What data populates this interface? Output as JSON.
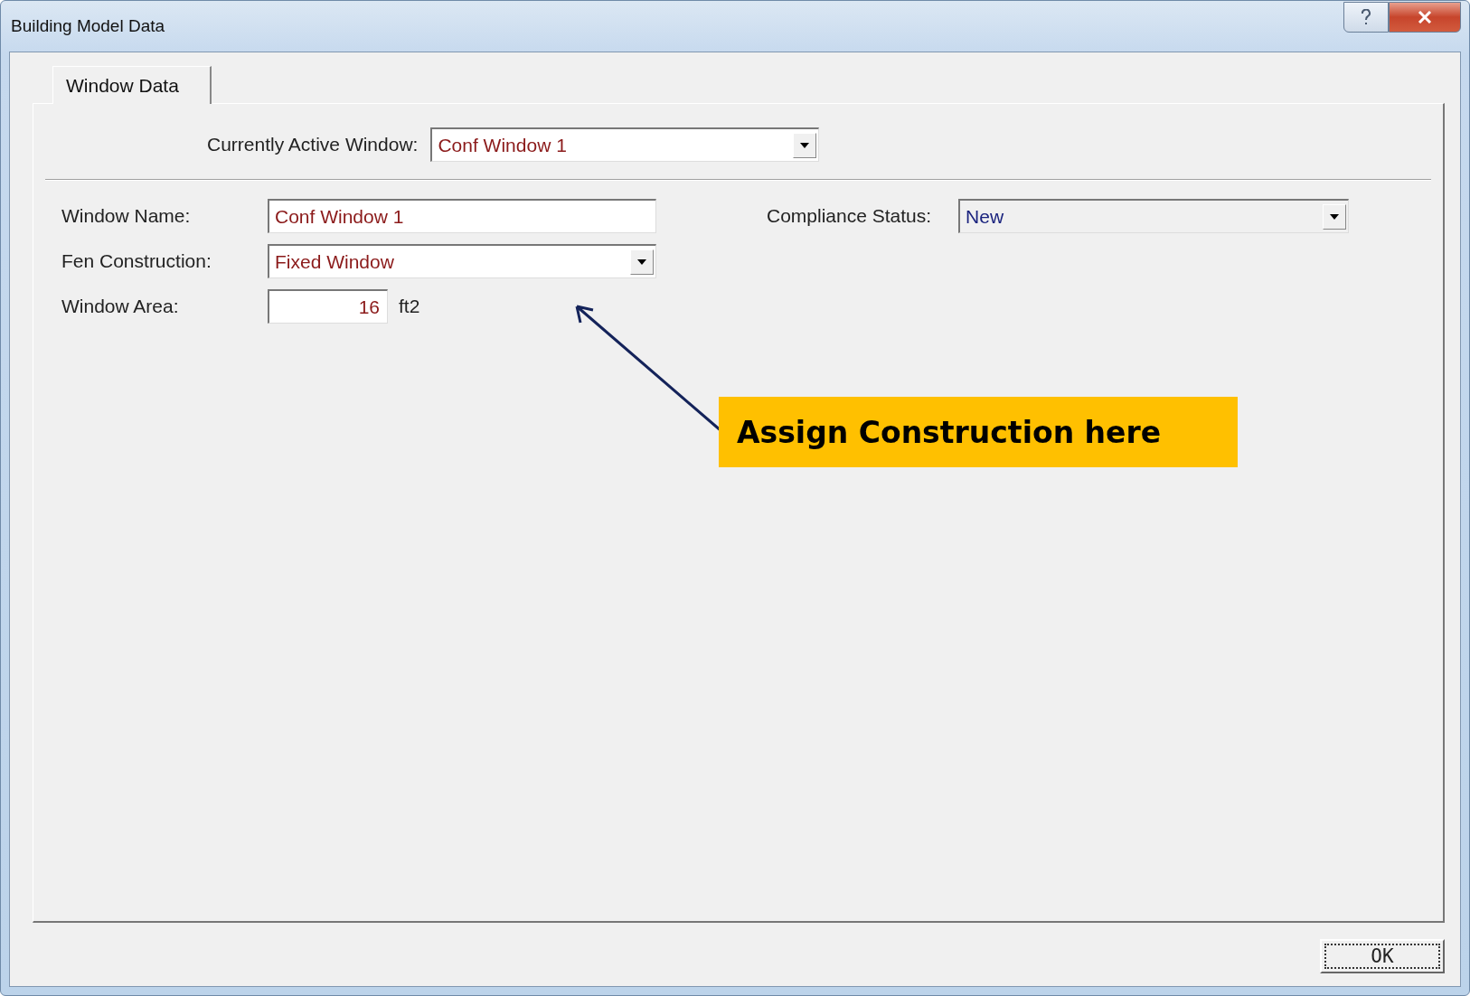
{
  "window": {
    "title": "Building Model Data"
  },
  "tabs": [
    {
      "label": "Window Data",
      "selected": true
    }
  ],
  "active_window": {
    "label": "Currently Active Window:",
    "value": "Conf Window 1"
  },
  "fields": [
    {
      "kind": "text",
      "label": "Window Name:",
      "value": "Conf Window 1"
    },
    {
      "kind": "dropdown",
      "label": "Fen Construction:",
      "value": "Fixed Window"
    },
    {
      "kind": "number",
      "label": "Window Area:",
      "value": "16",
      "unit": "ft2"
    }
  ],
  "compliance": {
    "label": "Compliance Status:",
    "value": "New"
  },
  "callout": {
    "text": "Assign Construction here"
  },
  "buttons": [
    {
      "label": "OK"
    }
  ]
}
